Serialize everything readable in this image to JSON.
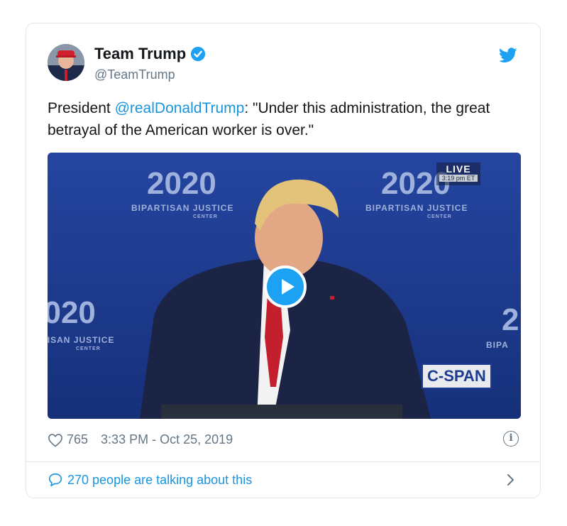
{
  "tweet": {
    "display_name": "Team Trump",
    "handle": "@TeamTrump",
    "text_before": "President ",
    "mention": "@realDonaldTrump",
    "text_after": ": \"Under this administration, the great betrayal of the American worker is over.\"",
    "likes": "765",
    "timestamp": "3:33 PM - Oct 25, 2019",
    "talking": "270 people are talking about this"
  },
  "video": {
    "backdrop_year": "2020",
    "backdrop_title": "BIPARTISAN JUSTICE",
    "backdrop_subtitle": "CENTER",
    "live_label": "LIVE",
    "live_time": "3:19 pm ET",
    "network_logo": "C-SPAN"
  },
  "icons": {
    "verified": "verified-badge-icon",
    "brand": "twitter-bird-icon",
    "play": "play-icon",
    "like": "heart-icon",
    "info": "info-icon",
    "reply": "speech-bubble-icon",
    "chevron": "chevron-right-icon"
  },
  "colors": {
    "link": "#1b95e0",
    "brand": "#1da1f2",
    "muted": "#657786",
    "backdrop": "#1f3b8c"
  }
}
